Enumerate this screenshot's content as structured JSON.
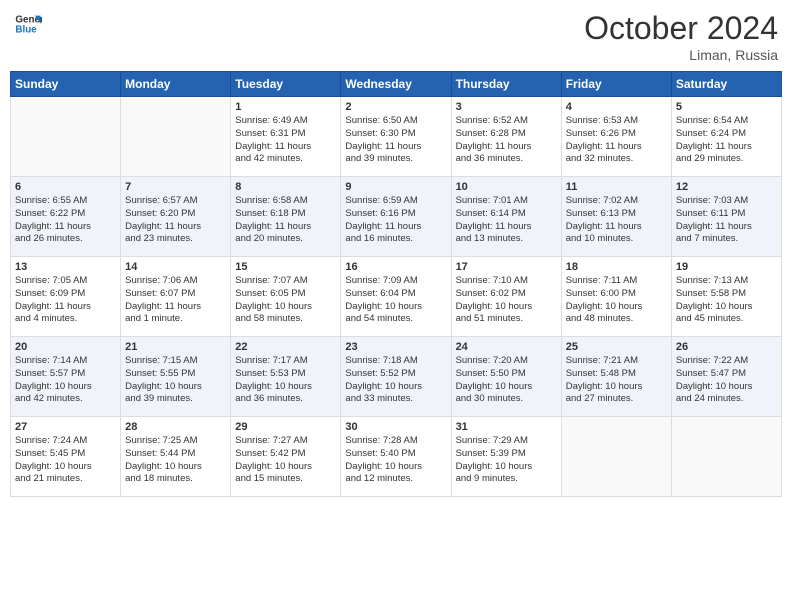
{
  "header": {
    "logo_line1": "General",
    "logo_line2": "Blue",
    "month_year": "October 2024",
    "location": "Liman, Russia"
  },
  "weekdays": [
    "Sunday",
    "Monday",
    "Tuesday",
    "Wednesday",
    "Thursday",
    "Friday",
    "Saturday"
  ],
  "weeks": [
    [
      {
        "day": "",
        "info": ""
      },
      {
        "day": "",
        "info": ""
      },
      {
        "day": "1",
        "info": "Sunrise: 6:49 AM\nSunset: 6:31 PM\nDaylight: 11 hours\nand 42 minutes."
      },
      {
        "day": "2",
        "info": "Sunrise: 6:50 AM\nSunset: 6:30 PM\nDaylight: 11 hours\nand 39 minutes."
      },
      {
        "day": "3",
        "info": "Sunrise: 6:52 AM\nSunset: 6:28 PM\nDaylight: 11 hours\nand 36 minutes."
      },
      {
        "day": "4",
        "info": "Sunrise: 6:53 AM\nSunset: 6:26 PM\nDaylight: 11 hours\nand 32 minutes."
      },
      {
        "day": "5",
        "info": "Sunrise: 6:54 AM\nSunset: 6:24 PM\nDaylight: 11 hours\nand 29 minutes."
      }
    ],
    [
      {
        "day": "6",
        "info": "Sunrise: 6:55 AM\nSunset: 6:22 PM\nDaylight: 11 hours\nand 26 minutes."
      },
      {
        "day": "7",
        "info": "Sunrise: 6:57 AM\nSunset: 6:20 PM\nDaylight: 11 hours\nand 23 minutes."
      },
      {
        "day": "8",
        "info": "Sunrise: 6:58 AM\nSunset: 6:18 PM\nDaylight: 11 hours\nand 20 minutes."
      },
      {
        "day": "9",
        "info": "Sunrise: 6:59 AM\nSunset: 6:16 PM\nDaylight: 11 hours\nand 16 minutes."
      },
      {
        "day": "10",
        "info": "Sunrise: 7:01 AM\nSunset: 6:14 PM\nDaylight: 11 hours\nand 13 minutes."
      },
      {
        "day": "11",
        "info": "Sunrise: 7:02 AM\nSunset: 6:13 PM\nDaylight: 11 hours\nand 10 minutes."
      },
      {
        "day": "12",
        "info": "Sunrise: 7:03 AM\nSunset: 6:11 PM\nDaylight: 11 hours\nand 7 minutes."
      }
    ],
    [
      {
        "day": "13",
        "info": "Sunrise: 7:05 AM\nSunset: 6:09 PM\nDaylight: 11 hours\nand 4 minutes."
      },
      {
        "day": "14",
        "info": "Sunrise: 7:06 AM\nSunset: 6:07 PM\nDaylight: 11 hours\nand 1 minute."
      },
      {
        "day": "15",
        "info": "Sunrise: 7:07 AM\nSunset: 6:05 PM\nDaylight: 10 hours\nand 58 minutes."
      },
      {
        "day": "16",
        "info": "Sunrise: 7:09 AM\nSunset: 6:04 PM\nDaylight: 10 hours\nand 54 minutes."
      },
      {
        "day": "17",
        "info": "Sunrise: 7:10 AM\nSunset: 6:02 PM\nDaylight: 10 hours\nand 51 minutes."
      },
      {
        "day": "18",
        "info": "Sunrise: 7:11 AM\nSunset: 6:00 PM\nDaylight: 10 hours\nand 48 minutes."
      },
      {
        "day": "19",
        "info": "Sunrise: 7:13 AM\nSunset: 5:58 PM\nDaylight: 10 hours\nand 45 minutes."
      }
    ],
    [
      {
        "day": "20",
        "info": "Sunrise: 7:14 AM\nSunset: 5:57 PM\nDaylight: 10 hours\nand 42 minutes."
      },
      {
        "day": "21",
        "info": "Sunrise: 7:15 AM\nSunset: 5:55 PM\nDaylight: 10 hours\nand 39 minutes."
      },
      {
        "day": "22",
        "info": "Sunrise: 7:17 AM\nSunset: 5:53 PM\nDaylight: 10 hours\nand 36 minutes."
      },
      {
        "day": "23",
        "info": "Sunrise: 7:18 AM\nSunset: 5:52 PM\nDaylight: 10 hours\nand 33 minutes."
      },
      {
        "day": "24",
        "info": "Sunrise: 7:20 AM\nSunset: 5:50 PM\nDaylight: 10 hours\nand 30 minutes."
      },
      {
        "day": "25",
        "info": "Sunrise: 7:21 AM\nSunset: 5:48 PM\nDaylight: 10 hours\nand 27 minutes."
      },
      {
        "day": "26",
        "info": "Sunrise: 7:22 AM\nSunset: 5:47 PM\nDaylight: 10 hours\nand 24 minutes."
      }
    ],
    [
      {
        "day": "27",
        "info": "Sunrise: 7:24 AM\nSunset: 5:45 PM\nDaylight: 10 hours\nand 21 minutes."
      },
      {
        "day": "28",
        "info": "Sunrise: 7:25 AM\nSunset: 5:44 PM\nDaylight: 10 hours\nand 18 minutes."
      },
      {
        "day": "29",
        "info": "Sunrise: 7:27 AM\nSunset: 5:42 PM\nDaylight: 10 hours\nand 15 minutes."
      },
      {
        "day": "30",
        "info": "Sunrise: 7:28 AM\nSunset: 5:40 PM\nDaylight: 10 hours\nand 12 minutes."
      },
      {
        "day": "31",
        "info": "Sunrise: 7:29 AM\nSunset: 5:39 PM\nDaylight: 10 hours\nand 9 minutes."
      },
      {
        "day": "",
        "info": ""
      },
      {
        "day": "",
        "info": ""
      }
    ]
  ]
}
